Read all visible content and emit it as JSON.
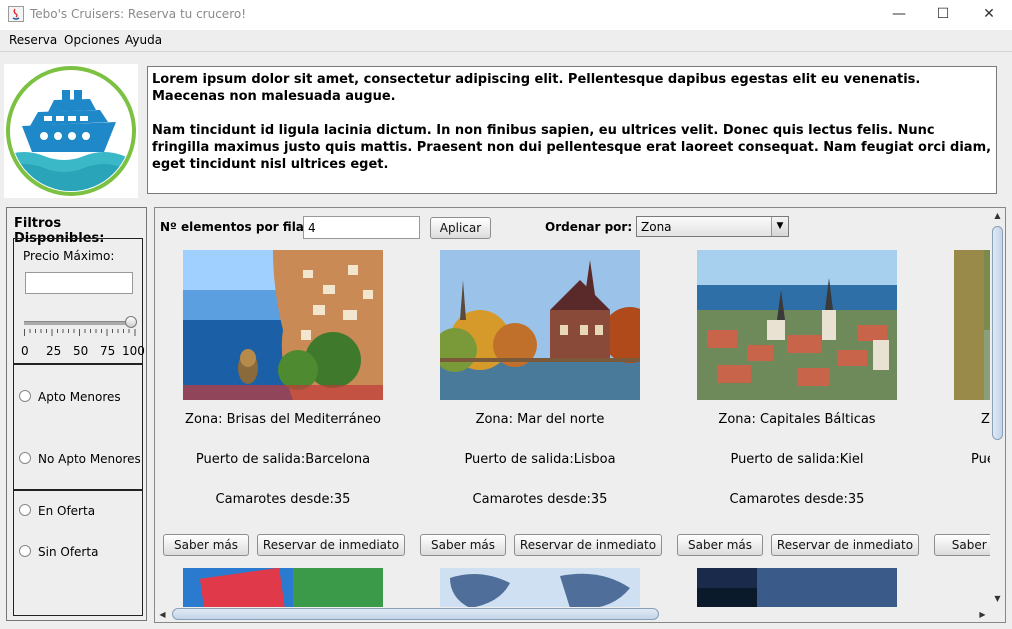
{
  "window": {
    "title": "Tebo's Cruisers: Reserva tu crucero!",
    "controls": [
      "—",
      "☐",
      "✕"
    ]
  },
  "menu": [
    "Reserva",
    "Opciones",
    "Ayuda"
  ],
  "description": {
    "paragraph1": "Lorem ipsum dolor sit amet, consectetur adipiscing elit. Pellentesque dapibus egestas elit eu venenatis. Maecenas non malesuada augue.",
    "paragraph2": "Nam tincidunt id ligula lacinia dictum. In non finibus sapien, eu ultrices velit. Donec quis lectus felis. Nunc fringilla maximus justo quis mattis. Praesent non dui pellentesque erat laoreet consequat. Nam feugiat orci diam, eget tincidunt nisl ultrices eget."
  },
  "filters": {
    "title": "Filtros Disponibles:",
    "price_label": "Precio Máximo:",
    "price_value": "",
    "slider_ticks": [
      "0",
      "25",
      "50",
      "75",
      "100"
    ],
    "slider_value": 100,
    "apto_menores": "Apto Menores",
    "no_apto_menores": "No Apto Menores",
    "en_oferta": "En Oferta",
    "sin_oferta": "Sin Oferta"
  },
  "toolbar": {
    "per_row_label": "Nº elementos por fila",
    "per_row_value": "4",
    "apply_label": "Aplicar",
    "sort_label": "Ordenar por:",
    "sort_value": "Zona"
  },
  "cards": [
    {
      "zona": "Zona: Brisas del Mediterráneo",
      "puerto": "Puerto de salida:Barcelona",
      "camarotes": "Camarotes desde:35",
      "more": "Saber más",
      "book": "Reservar de inmediato"
    },
    {
      "zona": "Zona: Mar del norte",
      "puerto": "Puerto de salida:Lisboa",
      "camarotes": "Camarotes desde:35",
      "more": "Saber más",
      "book": "Reservar de inmediato"
    },
    {
      "zona": "Zona: Capitales Bálticas",
      "puerto": "Puerto de salida:Kiel",
      "camarotes": "Camarotes desde:35",
      "more": "Saber más",
      "book": "Reservar de inmediato"
    },
    {
      "zona": "Zo",
      "puerto": "Pue",
      "more": "Saber m"
    }
  ],
  "colors": {
    "logo_ring": "#7cc142",
    "logo_ship": "#1e88c8",
    "logo_wave": "#3bb8c8"
  }
}
